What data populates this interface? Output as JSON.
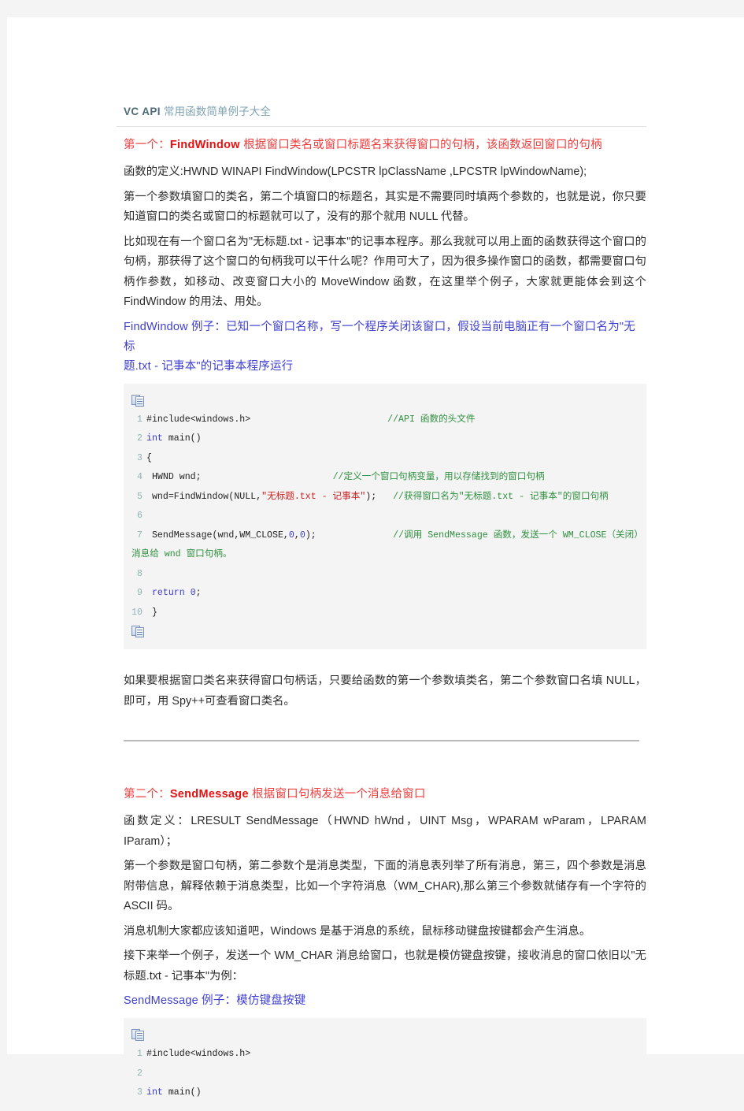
{
  "document": {
    "title_strong": "VC API",
    "title_rest": "常用函数简单例子大全"
  },
  "sections": [
    {
      "heading_prefix": "第一个：",
      "heading_name": "FindWindow",
      "heading_rest": " 根据窗口类名或窗口标题名来获得窗口的句柄，该函数返回窗口的句柄"
    },
    {
      "heading_prefix": "第二个：",
      "heading_name": "SendMessage",
      "heading_rest": " 根据窗口句柄发送一个消息给窗口"
    }
  ],
  "paragraphs": {
    "p1": "函数的定义:HWND WINAPI FindWindow(LPCSTR lpClassName ,LPCSTR lpWindowName);",
    "p2": "第一个参数填窗口的类名，第二个填窗口的标题名，其实是不需要同时填两个参数的，也就是说，你只要知道窗口的类名或窗口的标题就可以了，没有的那个就用 NULL 代替。",
    "p3": "比如现在有一个窗口名为\"无标题.txt - 记事本\"的记事本程序。那么我就可以用上面的函数获得这个窗口的句柄，那获得了这个窗口的句柄我可以干什么呢？作用可大了，因为很多操作窗口的函数，都需要窗口句柄作参数，如移动、改变窗口大小的 MoveWindow 函数，在这里举个例子，大家就更能体会到这个 FindWindow 的用法、用处。",
    "p4": "如果要根据窗口类名来获得窗口句柄话，只要给函数的第一个参数填类名，第二个参数窗口名填 NULL，即可，用 Spy++可查看窗口类名。",
    "p5": "函数定义：LRESULT SendMessage（HWND hWnd，UINT Msg，WPARAM wParam，LPARAM IParam）；",
    "p6": "第一个参数是窗口句柄，第二参数个是消息类型，下面的消息表列举了所有消息，第三，四个参数是消息附带信息，解释依赖于消息类型，比如一个字符消息（WM_CHAR),那么第三个参数就储存有一个字符的 ASCII 码。",
    "p7": "消息机制大家都应该知道吧，Windows 是基于消息的系统，鼠标移动键盘按键都会产生消息。",
    "p8": "接下来举一个例子，发送一个 WM_CHAR 消息给窗口，也就是模仿键盘按键，接收消息的窗口依旧以\"无标题.txt - 记事本\"为例："
  },
  "example_headings": {
    "ex1_line1": "FindWindow 例子：已知一个窗口名称，写一个程序关闭该窗口，假设当前电脑正有一个窗口名为\"无标",
    "ex1_line2": "题.txt - 记事本\"的记事本程序运行",
    "ex2": "SendMessage 例子：模仿键盘按键"
  },
  "code_block_1": {
    "copy_icon": "copy-icon",
    "lines": [
      {
        "no": "1",
        "parts": [
          {
            "t": "#include<windows.h>",
            "c": "plain"
          },
          {
            "t": "                         ",
            "c": "plain"
          },
          {
            "t": "//API 函数的头文件",
            "c": "cmt"
          }
        ]
      },
      {
        "no": "2",
        "parts": [
          {
            "t": "int",
            "c": "kw"
          },
          {
            "t": " main()",
            "c": "plain"
          }
        ]
      },
      {
        "no": "3",
        "parts": [
          {
            "t": "{",
            "c": "plain"
          }
        ]
      },
      {
        "no": "4",
        "parts": [
          {
            "t": " HWND wnd;",
            "c": "plain"
          },
          {
            "t": "                        ",
            "c": "plain"
          },
          {
            "t": "//定义一个窗口句柄变量，用以存储找到的窗口句柄",
            "c": "cmt"
          }
        ]
      },
      {
        "no": "5",
        "parts": [
          {
            "t": " wnd=FindWindow(NULL,",
            "c": "plain"
          },
          {
            "t": "\"无标题.txt - 记事本\"",
            "c": "str"
          },
          {
            "t": ");   ",
            "c": "plain"
          },
          {
            "t": "//获得窗口名为\"无标题.txt - 记事本\"的窗口句柄",
            "c": "cmt"
          }
        ]
      },
      {
        "no": "6",
        "parts": []
      },
      {
        "no": "7",
        "parts": [
          {
            "t": " SendMessage(wnd,WM_CLOSE,",
            "c": "plain"
          },
          {
            "t": "0",
            "c": "num"
          },
          {
            "t": ",",
            "c": "plain"
          },
          {
            "t": "0",
            "c": "num"
          },
          {
            "t": ");              ",
            "c": "plain"
          },
          {
            "t": "//调用 SendMessage 函数，发送一个 WM_CLOSE（关闭）消息给 wnd 窗口句柄。",
            "c": "cmt"
          }
        ]
      },
      {
        "no": "8",
        "parts": []
      },
      {
        "no": "9",
        "parts": [
          {
            "t": " ",
            "c": "plain"
          },
          {
            "t": "return",
            "c": "kw"
          },
          {
            "t": " ",
            "c": "plain"
          },
          {
            "t": "0",
            "c": "num"
          },
          {
            "t": ";",
            "c": "plain"
          }
        ]
      },
      {
        "no": "10",
        "parts": [
          {
            "t": " }",
            "c": "plain"
          }
        ]
      }
    ]
  },
  "code_block_2": {
    "copy_icon": "copy-icon",
    "lines": [
      {
        "no": "1",
        "parts": [
          {
            "t": "#include<windows.h>",
            "c": "plain"
          }
        ]
      },
      {
        "no": "2",
        "parts": []
      },
      {
        "no": "3",
        "parts": [
          {
            "t": "int",
            "c": "kw"
          },
          {
            "t": " main()",
            "c": "plain"
          }
        ]
      }
    ]
  },
  "colors": {
    "page_bg": "#f4f4f4",
    "sheet": "#ffffff",
    "heading_red": "#ef3d3d",
    "heading_red_bold": "#e81010",
    "heading_blue": "#4040cf",
    "title_strong": "#4b6b78",
    "title_rest": "#7fa3b0",
    "code_bg": "#f4f4f4",
    "code_comment": "#2f8f3f",
    "code_keyword": "#3b3bc4",
    "code_string": "#cc1f1f",
    "line_number": "#8fb3b3",
    "divider": "#b9b9b9"
  }
}
